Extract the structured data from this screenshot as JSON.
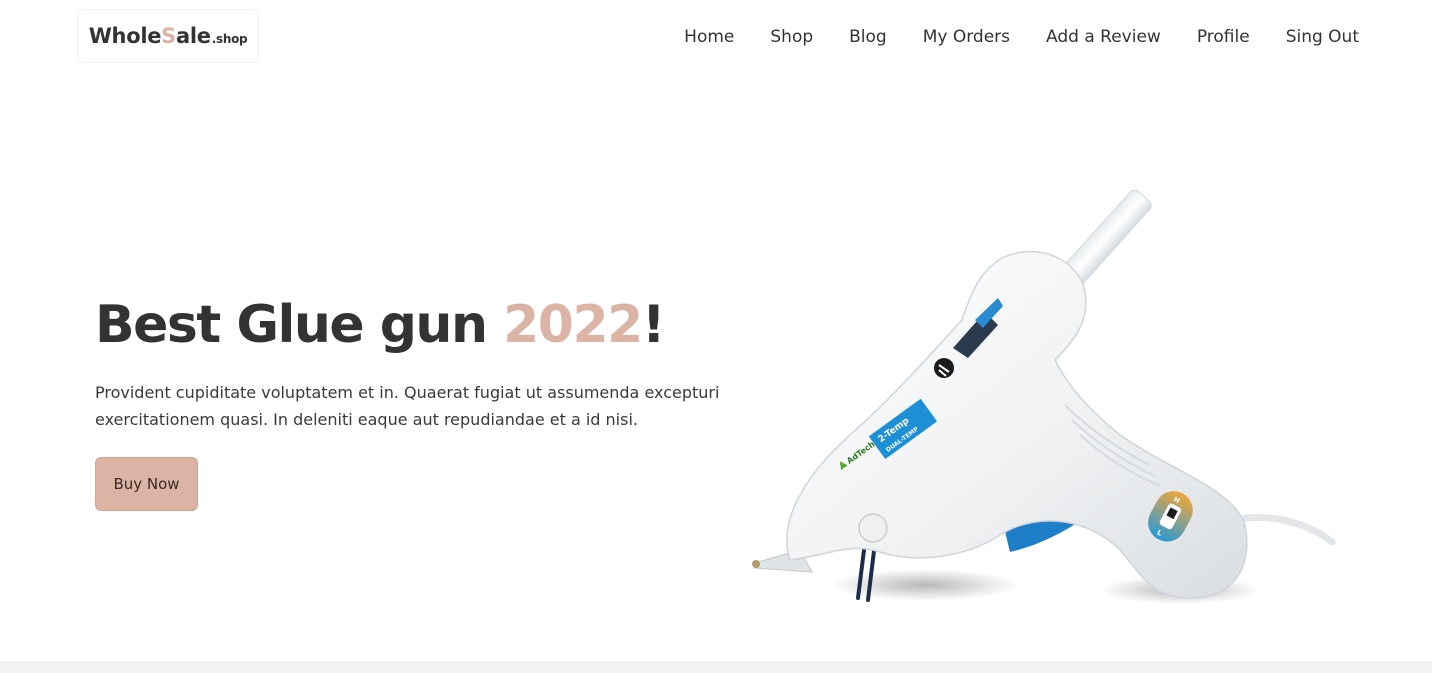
{
  "header": {
    "logo": {
      "main": "Whole",
      "accent": "S",
      "rest": "ale",
      "tld": ".shop"
    },
    "nav": [
      "Home",
      "Shop",
      "Blog",
      "My Orders",
      "Add a Review",
      "Profile",
      "Sing Out"
    ]
  },
  "hero": {
    "title_main": "Best Glue gun ",
    "title_year": "2022",
    "title_end": "!",
    "description": "Provident cupiditate voluptatem et in. Quaerat fugiat ut assumenda excepturi exercitationem quasi. In deleniti eaque aut repudiandae et a id nisi.",
    "button_label": "Buy Now",
    "product": {
      "brand": "AdTech",
      "label_line1": "2-Temp",
      "label_line2": "DUAL-TEMP",
      "switch_high": "H",
      "switch_low": "L"
    }
  },
  "colors": {
    "accent": "#dbb4a6",
    "text": "#333333",
    "trigger": "#1e7fc8"
  }
}
